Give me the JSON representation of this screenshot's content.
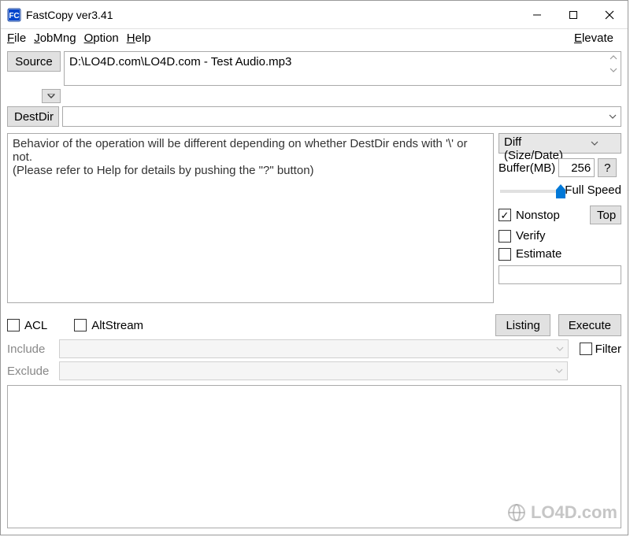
{
  "titlebar": {
    "title": "FastCopy ver3.41"
  },
  "menu": {
    "file": "File",
    "jobmng": "JobMng",
    "option": "Option",
    "help": "Help",
    "elevate": "Elevate"
  },
  "source": {
    "button": "Source",
    "value": "D:\\LO4D.com\\LO4D.com - Test Audio.mp3"
  },
  "dest": {
    "button": "DestDir",
    "value": ""
  },
  "behavior": {
    "line1": "Behavior of the operation will be different depending on whether DestDir ends with '\\' or not.",
    "line2": "(Please refer to Help for details by pushing the \"?\" button)"
  },
  "mode": {
    "selected": "Diff (Size/Date)"
  },
  "buffer": {
    "label": "Buffer(MB)",
    "value": "256",
    "help": "?"
  },
  "speed": {
    "label": "Full Speed"
  },
  "checks": {
    "nonstop": "Nonstop",
    "verify": "Verify",
    "estimate": "Estimate",
    "top": "Top"
  },
  "acl": {
    "label": "ACL"
  },
  "altstream": {
    "label": "AltStream"
  },
  "listing": {
    "label": "Listing"
  },
  "execute": {
    "label": "Execute"
  },
  "include": {
    "label": "Include"
  },
  "exclude": {
    "label": "Exclude"
  },
  "filter": {
    "label": "Filter"
  },
  "watermark": "LO4D.com"
}
